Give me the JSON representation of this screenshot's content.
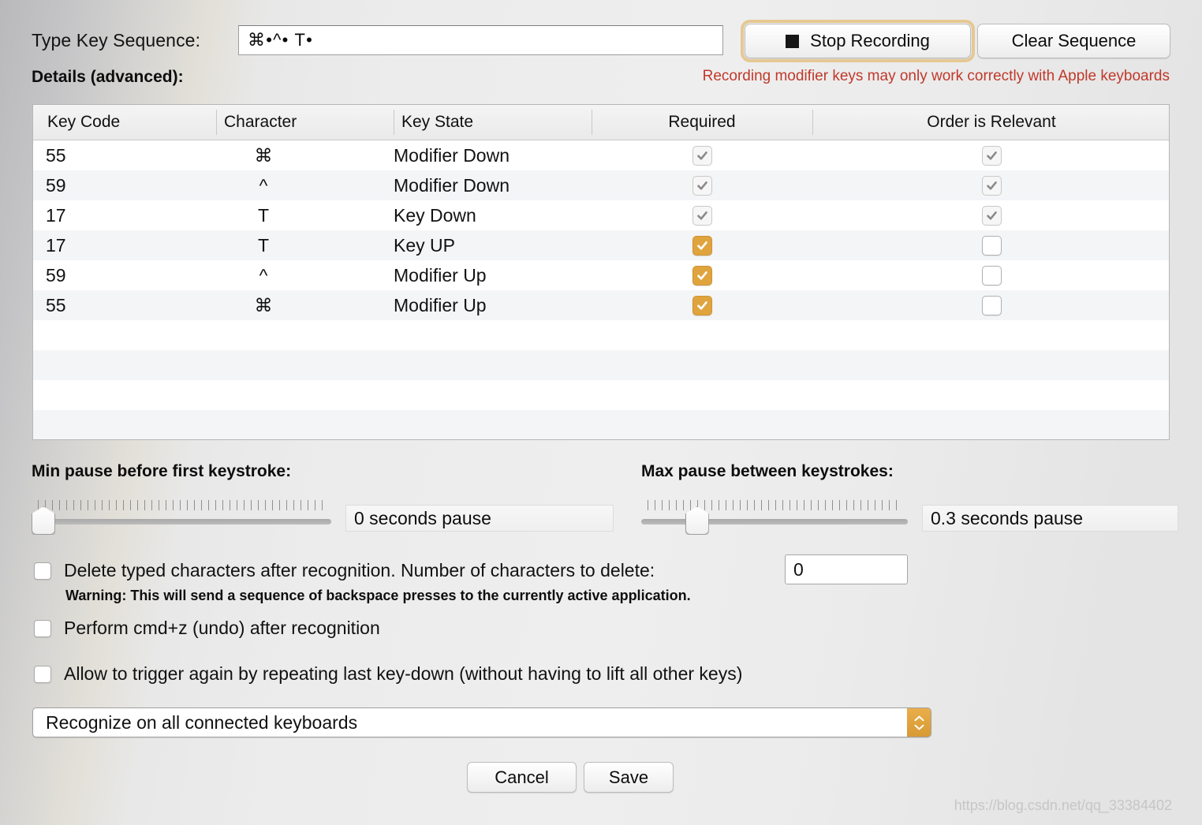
{
  "header": {
    "sequence_label": "Type Key Sequence:",
    "sequence_value": "⌘•^• T•",
    "stop_recording_label": "Stop Recording",
    "clear_sequence_label": "Clear Sequence",
    "details_label": "Details (advanced):",
    "recording_warning": "Recording modifier keys may only work correctly with Apple keyboards"
  },
  "table": {
    "columns": [
      "Key Code",
      "Character",
      "Key State",
      "Required",
      "Order is Relevant"
    ],
    "rows": [
      {
        "key_code": "55",
        "character": "⌘",
        "key_state": "Modifier Down",
        "required": "dim",
        "order_relevant": "dim"
      },
      {
        "key_code": "59",
        "character": "^",
        "key_state": "Modifier Down",
        "required": "dim",
        "order_relevant": "dim"
      },
      {
        "key_code": "17",
        "character": "T",
        "key_state": "Key Down",
        "required": "dim",
        "order_relevant": "dim"
      },
      {
        "key_code": "17",
        "character": "T",
        "key_state": "Key UP",
        "required": "on",
        "order_relevant": "off"
      },
      {
        "key_code": "59",
        "character": "^",
        "key_state": "Modifier Up",
        "required": "on",
        "order_relevant": "off"
      },
      {
        "key_code": "55",
        "character": "⌘",
        "key_state": "Modifier Up",
        "required": "on",
        "order_relevant": "off"
      }
    ],
    "empty_row_count": 5
  },
  "sliders": {
    "min_pause": {
      "title": "Min pause before first keystroke:",
      "value_text": "0 seconds pause",
      "thumb_percent": 0
    },
    "max_pause": {
      "title": "Max pause between keystrokes:",
      "value_text": "0.3 seconds pause",
      "thumb_percent": 18
    }
  },
  "options": {
    "delete_typed": {
      "label": "Delete typed characters after recognition. Number of characters to delete:",
      "checked": false,
      "count_value": "0"
    },
    "warning_line": "Warning: This will send a sequence of backspace presses to the currently active application.",
    "perform_undo": {
      "label": "Perform cmd+z (undo) after recognition",
      "checked": false
    },
    "allow_retrigger": {
      "label": "Allow to trigger again by repeating last key-down (without having to lift all other keys)",
      "checked": false
    }
  },
  "keyboard_scope": {
    "selected": "Recognize on all connected keyboards"
  },
  "footer": {
    "cancel_label": "Cancel",
    "save_label": "Save"
  },
  "watermark": "https://blog.csdn.net/qq_33384402",
  "colors": {
    "accent_orange": "#e0a43e",
    "focus_ring": "#e6c893",
    "warning_red": "#c0392b"
  }
}
